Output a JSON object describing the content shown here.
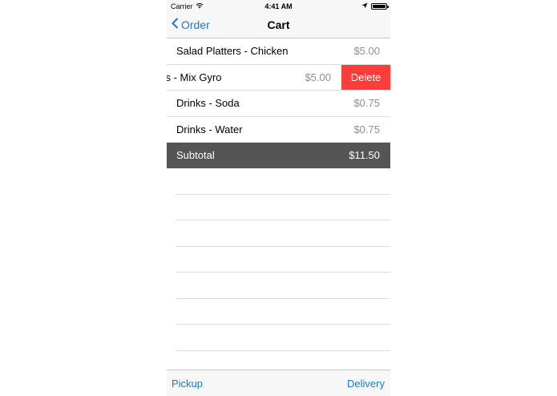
{
  "status_bar": {
    "carrier": "Carrier",
    "time": "4:41 AM",
    "battery_level": 1.0
  },
  "nav": {
    "back_label": "Order",
    "title": "Cart"
  },
  "cart": {
    "items": [
      {
        "name": "Salad Platters - Chicken",
        "price": "$5.00"
      },
      {
        "name": "nes - Mix Gyro",
        "price": "$5.00",
        "swiped": true,
        "delete_label": "Delete"
      },
      {
        "name": "Drinks - Soda",
        "price": "$0.75"
      },
      {
        "name": "Drinks - Water",
        "price": "$0.75"
      }
    ],
    "subtotal_label": "Subtotal",
    "subtotal_value": "$11.50"
  },
  "toolbar": {
    "left_label": "Pickup",
    "right_label": "Delivery"
  },
  "colors": {
    "tint": "#1e7ac6",
    "delete": "#fc3d39",
    "subtotal_bg": "#555555"
  }
}
